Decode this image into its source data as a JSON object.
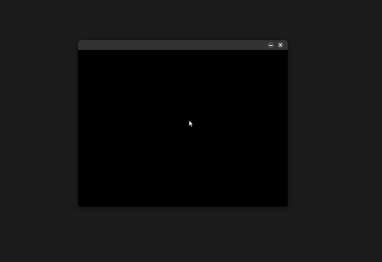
{
  "colors": {
    "desktop_bg": "#1c1c1c",
    "titlebar_bg": "#323232",
    "window_content_bg": "#000000",
    "button_bg": "#4a4a4a",
    "button_glyph": "#e6e6e6",
    "cursor_fill": "#f2f2f2",
    "cursor_outline": "#111111"
  },
  "window": {
    "title": "",
    "buttons": [
      {
        "name": "minimize",
        "icon": "minimize-icon"
      },
      {
        "name": "close",
        "icon": "close-icon"
      }
    ]
  },
  "cursor": {
    "icon": "pointer-arrow-icon"
  }
}
